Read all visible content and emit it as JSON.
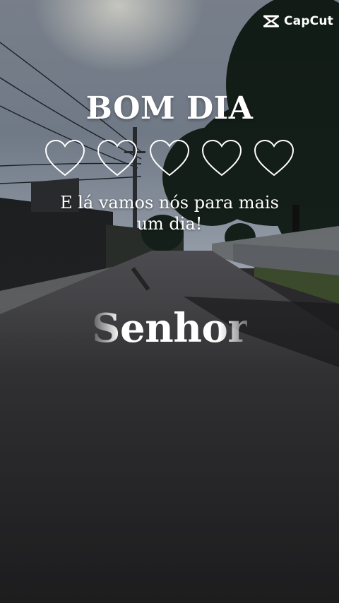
{
  "brand": {
    "name": "CapCut"
  },
  "overlay": {
    "title": "BOM DIA",
    "hearts": [
      "heart",
      "heart",
      "heart",
      "heart",
      "heart"
    ],
    "message_line1": "E lá vamos nós para mais",
    "message_line2": "um dia!",
    "word": "Senhor"
  }
}
